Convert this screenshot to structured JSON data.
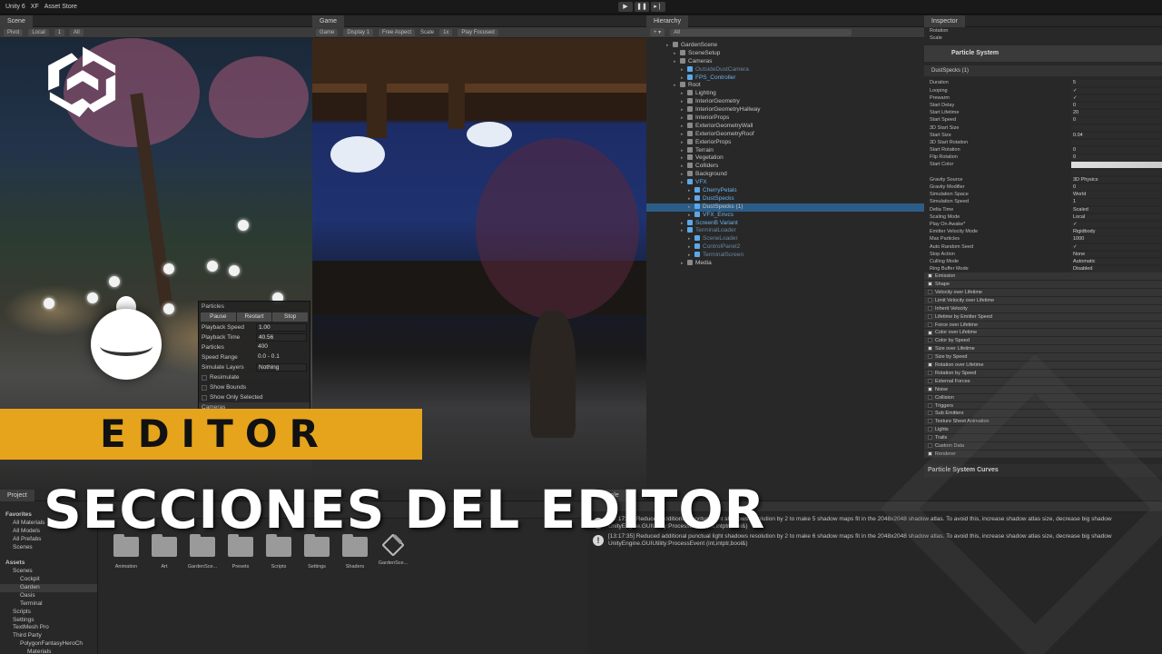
{
  "topbar": {
    "app": "Unity 6",
    "account": "XF",
    "store": "Asset Store"
  },
  "scene": {
    "tab": "Scene",
    "toolbar": [
      "Pivot",
      "Local",
      "1",
      "All"
    ],
    "overlay": {
      "title": "Particles",
      "buttons": [
        "Pause",
        "Restart",
        "Stop"
      ],
      "rows": [
        {
          "k": "Playback Speed",
          "v": "1.00"
        },
        {
          "k": "Playback Time",
          "v": "40.56"
        },
        {
          "k": "Particles",
          "v": "400"
        },
        {
          "k": "Speed Range",
          "v": "0.0 - 0.1"
        },
        {
          "k": "Simulate Layers",
          "v": "Nothing"
        }
      ],
      "checks": [
        "Resimulate",
        "Show Bounds",
        "Show Only Selected"
      ],
      "footer": "Cameras"
    }
  },
  "game": {
    "tab": "Game",
    "toolbar": [
      "Game",
      "Display 1",
      "Free Aspect",
      "Scale",
      "1x",
      "Play Focused"
    ]
  },
  "hierarchy": {
    "tab": "Hierarchy",
    "search": "All",
    "rows": [
      {
        "t": "GardenScene",
        "d": 0,
        "c": ""
      },
      {
        "t": "SceneSetup",
        "d": 1,
        "c": ""
      },
      {
        "t": "Cameras",
        "d": 1,
        "c": ""
      },
      {
        "t": "OutsideDustCamera",
        "d": 2,
        "c": "dim"
      },
      {
        "t": "FPS_Controller",
        "d": 2,
        "c": "blue"
      },
      {
        "t": "Root",
        "d": 1,
        "c": ""
      },
      {
        "t": "Lighting",
        "d": 2,
        "c": ""
      },
      {
        "t": "InteriorGeometry",
        "d": 2,
        "c": ""
      },
      {
        "t": "InteriorGeometryHallway",
        "d": 2,
        "c": ""
      },
      {
        "t": "InteriorProps",
        "d": 2,
        "c": ""
      },
      {
        "t": "ExteriorGeometryWall",
        "d": 2,
        "c": ""
      },
      {
        "t": "ExteriorGeometryRoof",
        "d": 2,
        "c": ""
      },
      {
        "t": "ExteriorProps",
        "d": 2,
        "c": ""
      },
      {
        "t": "Terrain",
        "d": 2,
        "c": ""
      },
      {
        "t": "Vegetation",
        "d": 2,
        "c": ""
      },
      {
        "t": "Colliders",
        "d": 2,
        "c": ""
      },
      {
        "t": "Background",
        "d": 2,
        "c": ""
      },
      {
        "t": "VFX",
        "d": 2,
        "c": "blue"
      },
      {
        "t": "CherryPetals",
        "d": 3,
        "c": "blue"
      },
      {
        "t": "DustSpecks",
        "d": 3,
        "c": "blue"
      },
      {
        "t": "DustSpecks (1)",
        "d": 3,
        "c": "sel"
      },
      {
        "t": "VFX_Envcs",
        "d": 3,
        "c": "blue"
      },
      {
        "t": "ScreenB Variant",
        "d": 2,
        "c": "blue"
      },
      {
        "t": "TerminalLoader",
        "d": 2,
        "c": "dim"
      },
      {
        "t": "SceneLoader",
        "d": 3,
        "c": "dim"
      },
      {
        "t": "ControlPanel2",
        "d": 3,
        "c": "dim"
      },
      {
        "t": "TerminalScreen",
        "d": 3,
        "c": "dim"
      },
      {
        "t": "Media",
        "d": 2,
        "c": ""
      }
    ]
  },
  "inspector": {
    "tab": "Inspector",
    "transform": {
      "rotation": "Rotation",
      "scale": "Scale"
    },
    "component": "Particle System",
    "subheader": "DustSpecks (1)",
    "props": [
      {
        "k": "Duration",
        "v": "5"
      },
      {
        "k": "Looping",
        "v": "✓"
      },
      {
        "k": "Prewarm",
        "v": "✓"
      },
      {
        "k": "Start Delay",
        "v": "0"
      },
      {
        "k": "Start Lifetime",
        "v": "20"
      },
      {
        "k": "Start Speed",
        "v": "0"
      },
      {
        "k": "3D Start Size",
        "v": ""
      },
      {
        "k": "Start Size",
        "v": "0.04"
      },
      {
        "k": "3D Start Rotation",
        "v": ""
      },
      {
        "k": "Start Rotation",
        "v": "0"
      },
      {
        "k": "Flip Rotation",
        "v": "0"
      },
      {
        "k": "Start Color",
        "v": ""
      },
      {
        "k": "",
        "v": ""
      },
      {
        "k": "Gravity Source",
        "v": "3D Physics"
      },
      {
        "k": "Gravity Modifier",
        "v": "0"
      },
      {
        "k": "Simulation Space",
        "v": "World"
      },
      {
        "k": "Simulation Speed",
        "v": "1"
      },
      {
        "k": "Delta Time",
        "v": "Scaled"
      },
      {
        "k": "Scaling Mode",
        "v": "Local"
      },
      {
        "k": "Play On Awake*",
        "v": "✓"
      },
      {
        "k": "Emitter Velocity Mode",
        "v": "Rigidbody"
      },
      {
        "k": "Max Particles",
        "v": "1000"
      },
      {
        "k": "Auto Random Seed",
        "v": "✓"
      },
      {
        "k": "Stop Action",
        "v": "None"
      },
      {
        "k": "Culling Mode",
        "v": "Automatic"
      },
      {
        "k": "Ring Buffer Mode",
        "v": "Disabled"
      }
    ],
    "modules": [
      {
        "n": "Emission",
        "on": true
      },
      {
        "n": "Shape",
        "on": true
      },
      {
        "n": "Velocity over Lifetime",
        "on": false
      },
      {
        "n": "Limit Velocity over Lifetime",
        "on": false
      },
      {
        "n": "Inherit Velocity",
        "on": false
      },
      {
        "n": "Lifetime by Emitter Speed",
        "on": false
      },
      {
        "n": "Force over Lifetime",
        "on": false
      },
      {
        "n": "Color over Lifetime",
        "on": true
      },
      {
        "n": "Color by Speed",
        "on": false
      },
      {
        "n": "Size over Lifetime",
        "on": true
      },
      {
        "n": "Size by Speed",
        "on": false
      },
      {
        "n": "Rotation over Lifetime",
        "on": true
      },
      {
        "n": "Rotation by Speed",
        "on": false
      },
      {
        "n": "External Forces",
        "on": false
      },
      {
        "n": "Noise",
        "on": true
      },
      {
        "n": "Collision",
        "on": false
      },
      {
        "n": "Triggers",
        "on": false
      },
      {
        "n": "Sub Emitters",
        "on": false
      },
      {
        "n": "Texture Sheet Animation",
        "on": false
      },
      {
        "n": "Lights",
        "on": false
      },
      {
        "n": "Trails",
        "on": false
      },
      {
        "n": "Custom Data",
        "on": false
      },
      {
        "n": "Renderer",
        "on": true
      }
    ],
    "footer": "Particle System Curves"
  },
  "project": {
    "tab": "Project",
    "tree": [
      {
        "t": "Favorites",
        "d": 0,
        "b": true
      },
      {
        "t": "All Materials",
        "d": 1,
        "b": false
      },
      {
        "t": "All Models",
        "d": 1,
        "b": false
      },
      {
        "t": "All Prefabs",
        "d": 1,
        "b": false
      },
      {
        "t": "Scenes",
        "d": 1,
        "b": false
      },
      {
        "t": "",
        "d": 0,
        "b": false
      },
      {
        "t": "Assets",
        "d": 0,
        "b": true
      },
      {
        "t": "Scenes",
        "d": 1,
        "b": false
      },
      {
        "t": "Cockpit",
        "d": 2,
        "b": false
      },
      {
        "t": "Garden",
        "d": 2,
        "b": false
      },
      {
        "t": "Oasis",
        "d": 2,
        "b": false
      },
      {
        "t": "Terminal",
        "d": 2,
        "b": false
      },
      {
        "t": "Scripts",
        "d": 1,
        "b": false
      },
      {
        "t": "Settings",
        "d": 1,
        "b": false
      },
      {
        "t": "TextMesh Pro",
        "d": 1,
        "b": false
      },
      {
        "t": "Third Party",
        "d": 1,
        "b": false
      },
      {
        "t": "PolygonFantasyHeroCh",
        "d": 2,
        "b": false
      },
      {
        "t": "Materials",
        "d": 3,
        "b": false
      }
    ],
    "assets": [
      "Animation",
      "Art",
      "GardenSce...",
      "Presets",
      "Scripts",
      "Settings",
      "Shaders",
      "GardenSce..."
    ]
  },
  "console": {
    "tab": "Console",
    "messages": [
      {
        "l1": "[13:17:35] Reduced additional punctual light shadows resolution by 2 to make 5 shadow maps fit in the 2048x2048 shadow atlas. To avoid this, increase shadow atlas size, decrease big shadow",
        "l2": "UnityEngine.GUIUtility:ProcessEvent (int,intptr,bool&)"
      },
      {
        "l1": "[13:17:35] Reduced additional punctual light shadows resolution by 2 to make 6 shadow maps fit in the 2048x2048 shadow atlas. To avoid this, increase shadow atlas size, decrease big shadow",
        "l2": "UnityEngine.GUIUtility:ProcessEvent (int,intptr,bool&)"
      }
    ]
  },
  "overlay": {
    "banner": "EDITOR",
    "title": "SECCIONES DEL EDITOR"
  },
  "colors": {
    "banner": "#e6a41c",
    "selection": "#2c5d87",
    "accent_blue": "#6ab0ec"
  }
}
